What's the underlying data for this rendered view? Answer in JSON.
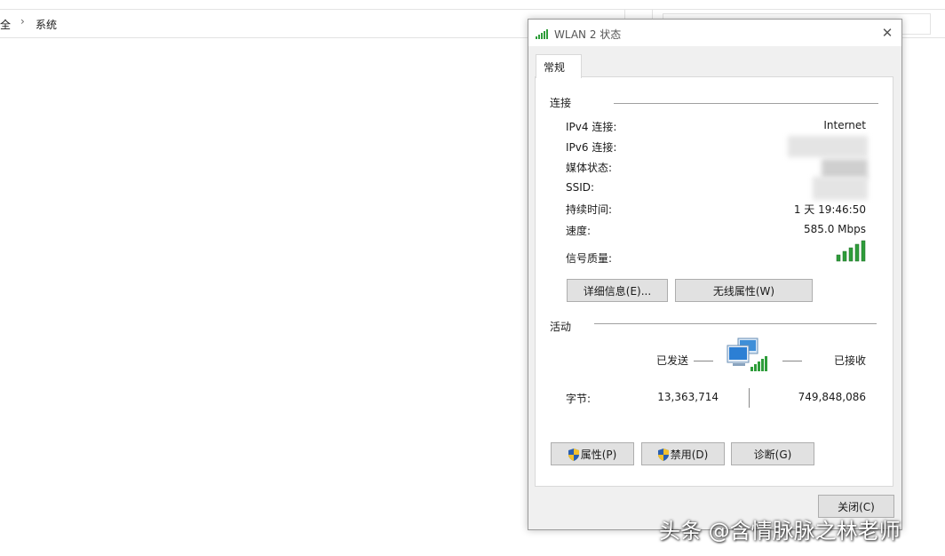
{
  "explorer": {
    "breadcrumb_prev": "安全",
    "breadcrumb_current": "系统"
  },
  "dialog": {
    "title": "WLAN 2 状态",
    "close_label": "✕",
    "tab": "常规",
    "connection": {
      "section": "连接",
      "rows": [
        {
          "label": "IPv4 连接:",
          "value": "Internet"
        },
        {
          "label": "IPv6 连接:",
          "value": ""
        },
        {
          "label": "媒体状态:",
          "value": ""
        },
        {
          "label": "SSID:",
          "value": ""
        },
        {
          "label": "持续时间:",
          "value": "1 天 19:46:50"
        },
        {
          "label": "速度:",
          "value": "585.0 Mbps"
        },
        {
          "label": "信号质量:",
          "value": "",
          "signal_level": "5/5"
        }
      ]
    },
    "buttons_mid": {
      "details": "详细信息(E)...",
      "wireless": "无线属性(W)"
    },
    "activity": {
      "section": "活动",
      "sent_label": "已发送",
      "received_label": "已接收",
      "bytes_label": "字节:",
      "bytes_sent": "13,363,714",
      "bytes_received": "749,848,086"
    },
    "buttons_bottom": {
      "properties": "属性(P)",
      "disable": "禁用(D)",
      "diagnose": "诊断(G)"
    },
    "close_button": "关闭(C)"
  },
  "watermark": "头条 @含情脉脉之林老师",
  "colors": {
    "signal_green": "#2e9d3a",
    "dialog_bg": "#f0f0f0",
    "button_bg": "#e1e1e1",
    "button_border": "#adadad"
  }
}
